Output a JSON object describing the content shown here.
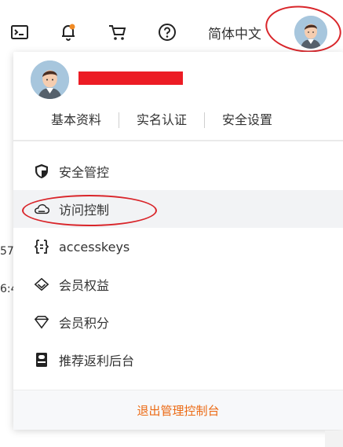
{
  "topbar": {
    "icons": [
      "terminal-icon",
      "notification-bell-icon",
      "cart-icon",
      "help-icon"
    ],
    "language": "简体中文"
  },
  "background": {
    "text_fragments": [
      "57",
      "6:4"
    ]
  },
  "profile": {
    "tabs": [
      "基本资料",
      "实名认证",
      "安全设置"
    ]
  },
  "menu": {
    "items": [
      {
        "label": "安全管控",
        "icon": "shield-icon"
      },
      {
        "label": "访问控制",
        "icon": "cloud-icon"
      },
      {
        "label": "accesskeys",
        "icon": "key-bracket-icon"
      },
      {
        "label": "会员权益",
        "icon": "diamond-icon"
      },
      {
        "label": "会员积分",
        "icon": "gem-icon"
      },
      {
        "label": "推荐返利后台",
        "icon": "card-icon"
      }
    ]
  },
  "footer": {
    "logout_label": "退出管理控制台"
  },
  "colors": {
    "accent": "#ec6a14",
    "annotation": "#d9252a",
    "redaction": "#ec1c24"
  }
}
